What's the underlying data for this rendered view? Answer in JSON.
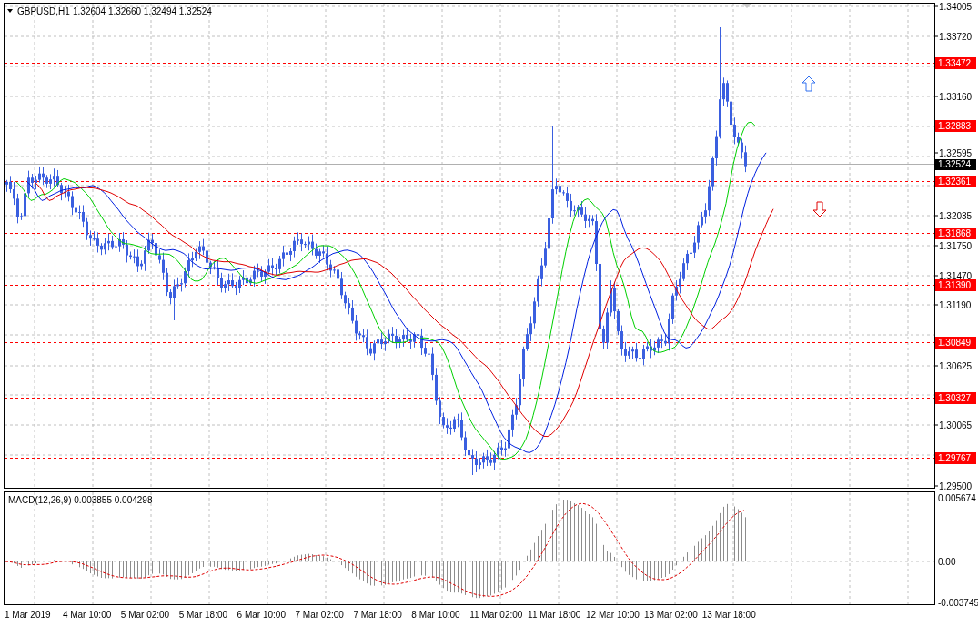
{
  "chart": {
    "symbol": "GBPUSD,H1",
    "ohlc": "1.32604 1.32660 1.32494 1.32524"
  },
  "price_axis": {
    "ticks": [
      "1.34005",
      "1.33720",
      "1.33160",
      "1.32595",
      "1.32035",
      "1.31750",
      "1.31470",
      "1.31190",
      "1.30625",
      "1.30065",
      "1.29500"
    ],
    "levels": [
      "1.33472",
      "1.32883",
      "1.32361",
      "1.31868",
      "1.31390",
      "1.30849",
      "1.30327",
      "1.29767"
    ],
    "current_price": "1.32524"
  },
  "macd": {
    "title": "MACD(12,26,9) 0.003855 0.004298",
    "ticks": [
      "0.005674",
      "0.00",
      "-0.003745"
    ]
  },
  "time_axis": [
    "1 Mar 2019",
    "4 Mar 10:00",
    "5 Mar 02:00",
    "5 Mar 18:00",
    "6 Mar 10:00",
    "7 Mar 02:00",
    "7 Mar 18:00",
    "8 Mar 10:00",
    "11 Mar 02:00",
    "11 Mar 18:00",
    "12 Mar 10:00",
    "13 Mar 02:00",
    "13 Mar 18:00"
  ]
}
